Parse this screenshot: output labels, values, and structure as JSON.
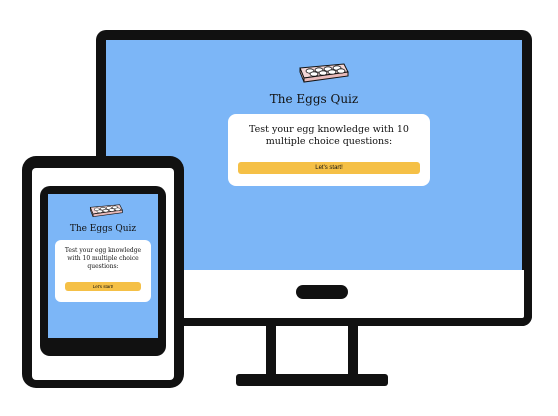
{
  "quiz": {
    "title": "The Eggs Quiz",
    "intro": "Test your egg knowledge with 10 multiple choice questions:",
    "start_label": "Let's start!"
  },
  "colors": {
    "screen_background": "#7cb6f7",
    "button": "#f5c046",
    "device_frame": "#111111",
    "card": "#ffffff",
    "egg_tray": "#f3d6d6"
  },
  "icons": {
    "logo": "egg-tray-icon"
  }
}
